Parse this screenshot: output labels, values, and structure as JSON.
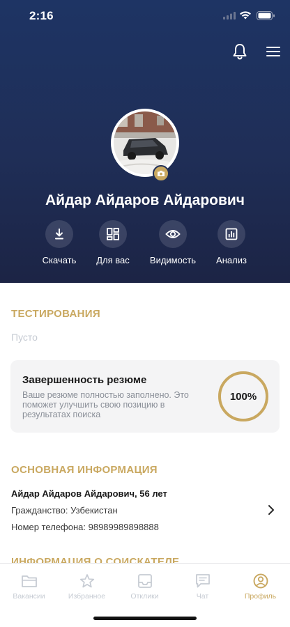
{
  "status_bar": {
    "time": "2:16"
  },
  "profile": {
    "full_name": "Айдар Айдаров Айдарович"
  },
  "actions": [
    {
      "label": "Скачать",
      "icon": "download-icon"
    },
    {
      "label": "Для вас",
      "icon": "grid-icon"
    },
    {
      "label": "Видимость",
      "icon": "eye-icon"
    },
    {
      "label": "Анализ",
      "icon": "chart-icon"
    }
  ],
  "testing": {
    "title": "ТЕСТИРОВАНИЯ",
    "empty_text": "Пусто"
  },
  "completeness": {
    "title": "Завершенность резюме",
    "description": "Ваше резюме полностью заполнено. Это поможет улучшить свою позицию в результатах поиска",
    "percent_label": "100%",
    "percent": 100
  },
  "basic_info": {
    "title": "ОСНОВНАЯ ИНФОРМАЦИЯ",
    "name_age": "Айдар Айдаров Айдарович, 56 лет",
    "citizenship": "Гражданство: Узбекистан",
    "phone": "Номер телефона: 98989989898888"
  },
  "seeker_info": {
    "title": "ИНФОРМАЦИЯ О СОИСКАТЕЛЕ"
  },
  "tabs": [
    {
      "label": "Вакансии",
      "icon": "folder-icon",
      "active": false
    },
    {
      "label": "Избранное",
      "icon": "star-icon",
      "active": false
    },
    {
      "label": "Отклики",
      "icon": "inbox-icon",
      "active": false
    },
    {
      "label": "Чат",
      "icon": "chat-icon",
      "active": false
    },
    {
      "label": "Профиль",
      "icon": "profile-icon",
      "active": true
    }
  ],
  "colors": {
    "accent": "#c9a860",
    "header_bg": "#1f2e57",
    "inactive": "#c6cbd3"
  }
}
